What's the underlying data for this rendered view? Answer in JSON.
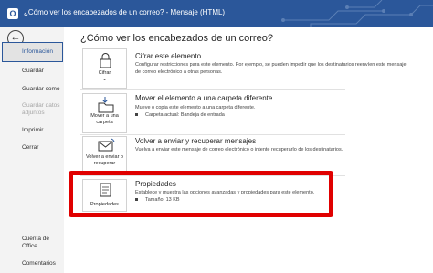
{
  "window": {
    "title": "¿Cómo ver los encabezados de un correo?  -  Mensaje (HTML)",
    "app_icon": "O"
  },
  "sidebar": {
    "items": [
      {
        "label": "Información",
        "active": true
      },
      {
        "label": "Guardar"
      },
      {
        "label": "Guardar como"
      },
      {
        "label": "Guardar datos adjuntos",
        "disabled": true
      },
      {
        "label": "Imprimir"
      },
      {
        "label": "Cerrar"
      },
      {
        "label": "Cuenta de Office"
      },
      {
        "label": "Comentarios"
      }
    ]
  },
  "main": {
    "title": "¿Cómo ver los encabezados de un correo?",
    "sections": [
      {
        "button_label": "Cifrar",
        "button_icon": "lock-icon",
        "title": "Cifrar este elemento",
        "description": "Configurar restricciones para este elemento. Por ejemplo, se pueden impedir que los destinatarios reenvíen este mensaje de correo electrónico a otras personas."
      },
      {
        "button_label": "Mover a una carpeta",
        "button_icon": "move-to-folder-icon",
        "title": "Mover el elemento a una carpeta diferente",
        "description": "Mueve o copia este elemento a una carpeta diferente.",
        "bullet": "Carpeta actual:    Bandeja de entrada"
      },
      {
        "button_label": "Volver a enviar o recuperar",
        "button_icon": "resend-envelope-icon",
        "title": "Volver a enviar y recuperar mensajes",
        "description": "Vuelva a enviar este mensaje de correo electrónico o intente recuperarlo de los destinatarios."
      },
      {
        "button_label": "Propiedades",
        "button_icon": "properties-icon",
        "title": "Propiedades",
        "description": "Establece y muestra las opciones avanzadas y propiedades para este elemento.",
        "bullet": "Tamaño:    13 KB"
      }
    ]
  },
  "colors": {
    "titlebar": "#2b579a",
    "highlight": "#e00000",
    "sidebar": "#f3f3f3"
  }
}
